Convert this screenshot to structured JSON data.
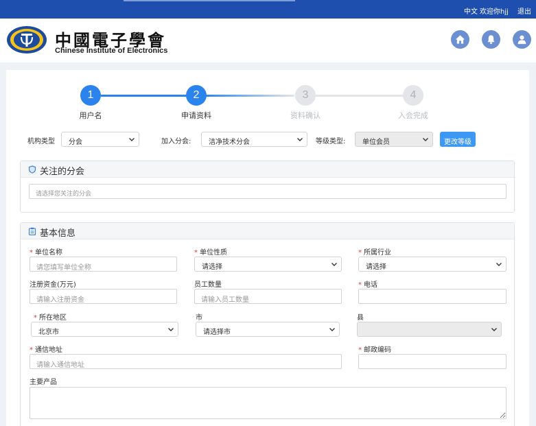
{
  "topbar": {
    "lang": "中文",
    "welcome": "欢迎你hjj",
    "logout": "退出"
  },
  "logo": {
    "cn": "中國電子學會",
    "en": "Chinese Institute of Electronics"
  },
  "header_icons": [
    "home-icon",
    "bell-icon",
    "user-icon"
  ],
  "steps": [
    {
      "num": "1",
      "label": "用户名",
      "state": "done"
    },
    {
      "num": "2",
      "label": "申请资料",
      "state": "current"
    },
    {
      "num": "3",
      "label": "资料确认",
      "state": "todo"
    },
    {
      "num": "4",
      "label": "入会完成",
      "state": "todo"
    }
  ],
  "filters": {
    "org_type_label": "机构类型",
    "org_type_value": "分会",
    "branch_label": "加入分会:",
    "branch_value": "洁净技术分会",
    "level_label": "等级类型:",
    "level_value": "单位会员",
    "change_level_btn": "更改等级"
  },
  "followed": {
    "title": "关注的分会",
    "placeholder": "请选择您关注的分会"
  },
  "basic": {
    "title": "基本信息",
    "unit_name_label": "单位名称",
    "unit_name_ph": "请您填写单位全称",
    "unit_nature_label": "单位性质",
    "unit_nature_value": "请选择",
    "industry_label": "所属行业",
    "industry_value": "请选择",
    "capital_label": "注册资金(万元)",
    "capital_ph": "请输入注册资金",
    "staff_label": "员工数量",
    "staff_ph": "请输入员工数量",
    "phone_label": "电话",
    "phone_ph": "",
    "region_label": "所在地区",
    "region_value": "北京市",
    "city_label": "市",
    "city_value": "请选择市",
    "county_label": "县",
    "county_value": "",
    "address_label": "通信地址",
    "address_ph": "请输入通信地址",
    "postcode_label": "邮政编码",
    "postcode_ph": "",
    "products_label": "主要产品"
  },
  "colors": {
    "topbar": "#1e4fae",
    "accent": "#2b84ee",
    "button": "#3d97f5",
    "required": "#e23c3c"
  }
}
